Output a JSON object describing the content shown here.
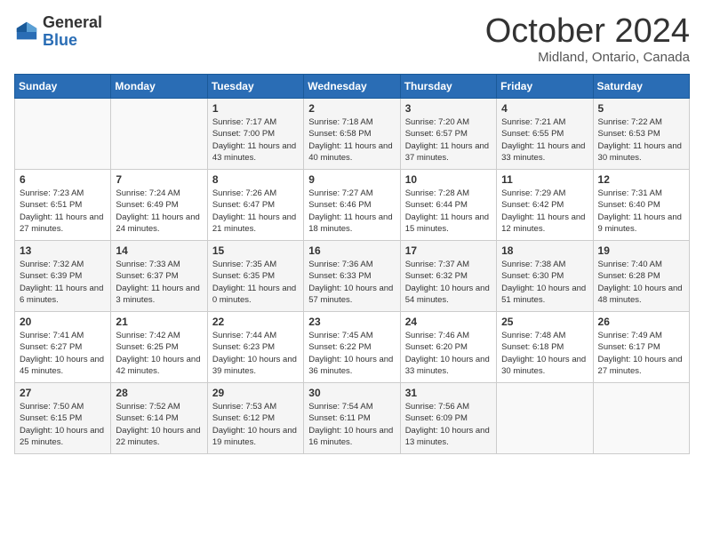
{
  "logo": {
    "general": "General",
    "blue": "Blue"
  },
  "title": "October 2024",
  "location": "Midland, Ontario, Canada",
  "weekdays": [
    "Sunday",
    "Monday",
    "Tuesday",
    "Wednesday",
    "Thursday",
    "Friday",
    "Saturday"
  ],
  "days": [
    {
      "date": null,
      "sunrise": null,
      "sunset": null,
      "daylight": null
    },
    {
      "date": null,
      "sunrise": null,
      "sunset": null,
      "daylight": null
    },
    {
      "date": "1",
      "sunrise": "Sunrise: 7:17 AM",
      "sunset": "Sunset: 7:00 PM",
      "daylight": "Daylight: 11 hours and 43 minutes."
    },
    {
      "date": "2",
      "sunrise": "Sunrise: 7:18 AM",
      "sunset": "Sunset: 6:58 PM",
      "daylight": "Daylight: 11 hours and 40 minutes."
    },
    {
      "date": "3",
      "sunrise": "Sunrise: 7:20 AM",
      "sunset": "Sunset: 6:57 PM",
      "daylight": "Daylight: 11 hours and 37 minutes."
    },
    {
      "date": "4",
      "sunrise": "Sunrise: 7:21 AM",
      "sunset": "Sunset: 6:55 PM",
      "daylight": "Daylight: 11 hours and 33 minutes."
    },
    {
      "date": "5",
      "sunrise": "Sunrise: 7:22 AM",
      "sunset": "Sunset: 6:53 PM",
      "daylight": "Daylight: 11 hours and 30 minutes."
    },
    {
      "date": "6",
      "sunrise": "Sunrise: 7:23 AM",
      "sunset": "Sunset: 6:51 PM",
      "daylight": "Daylight: 11 hours and 27 minutes."
    },
    {
      "date": "7",
      "sunrise": "Sunrise: 7:24 AM",
      "sunset": "Sunset: 6:49 PM",
      "daylight": "Daylight: 11 hours and 24 minutes."
    },
    {
      "date": "8",
      "sunrise": "Sunrise: 7:26 AM",
      "sunset": "Sunset: 6:47 PM",
      "daylight": "Daylight: 11 hours and 21 minutes."
    },
    {
      "date": "9",
      "sunrise": "Sunrise: 7:27 AM",
      "sunset": "Sunset: 6:46 PM",
      "daylight": "Daylight: 11 hours and 18 minutes."
    },
    {
      "date": "10",
      "sunrise": "Sunrise: 7:28 AM",
      "sunset": "Sunset: 6:44 PM",
      "daylight": "Daylight: 11 hours and 15 minutes."
    },
    {
      "date": "11",
      "sunrise": "Sunrise: 7:29 AM",
      "sunset": "Sunset: 6:42 PM",
      "daylight": "Daylight: 11 hours and 12 minutes."
    },
    {
      "date": "12",
      "sunrise": "Sunrise: 7:31 AM",
      "sunset": "Sunset: 6:40 PM",
      "daylight": "Daylight: 11 hours and 9 minutes."
    },
    {
      "date": "13",
      "sunrise": "Sunrise: 7:32 AM",
      "sunset": "Sunset: 6:39 PM",
      "daylight": "Daylight: 11 hours and 6 minutes."
    },
    {
      "date": "14",
      "sunrise": "Sunrise: 7:33 AM",
      "sunset": "Sunset: 6:37 PM",
      "daylight": "Daylight: 11 hours and 3 minutes."
    },
    {
      "date": "15",
      "sunrise": "Sunrise: 7:35 AM",
      "sunset": "Sunset: 6:35 PM",
      "daylight": "Daylight: 11 hours and 0 minutes."
    },
    {
      "date": "16",
      "sunrise": "Sunrise: 7:36 AM",
      "sunset": "Sunset: 6:33 PM",
      "daylight": "Daylight: 10 hours and 57 minutes."
    },
    {
      "date": "17",
      "sunrise": "Sunrise: 7:37 AM",
      "sunset": "Sunset: 6:32 PM",
      "daylight": "Daylight: 10 hours and 54 minutes."
    },
    {
      "date": "18",
      "sunrise": "Sunrise: 7:38 AM",
      "sunset": "Sunset: 6:30 PM",
      "daylight": "Daylight: 10 hours and 51 minutes."
    },
    {
      "date": "19",
      "sunrise": "Sunrise: 7:40 AM",
      "sunset": "Sunset: 6:28 PM",
      "daylight": "Daylight: 10 hours and 48 minutes."
    },
    {
      "date": "20",
      "sunrise": "Sunrise: 7:41 AM",
      "sunset": "Sunset: 6:27 PM",
      "daylight": "Daylight: 10 hours and 45 minutes."
    },
    {
      "date": "21",
      "sunrise": "Sunrise: 7:42 AM",
      "sunset": "Sunset: 6:25 PM",
      "daylight": "Daylight: 10 hours and 42 minutes."
    },
    {
      "date": "22",
      "sunrise": "Sunrise: 7:44 AM",
      "sunset": "Sunset: 6:23 PM",
      "daylight": "Daylight: 10 hours and 39 minutes."
    },
    {
      "date": "23",
      "sunrise": "Sunrise: 7:45 AM",
      "sunset": "Sunset: 6:22 PM",
      "daylight": "Daylight: 10 hours and 36 minutes."
    },
    {
      "date": "24",
      "sunrise": "Sunrise: 7:46 AM",
      "sunset": "Sunset: 6:20 PM",
      "daylight": "Daylight: 10 hours and 33 minutes."
    },
    {
      "date": "25",
      "sunrise": "Sunrise: 7:48 AM",
      "sunset": "Sunset: 6:18 PM",
      "daylight": "Daylight: 10 hours and 30 minutes."
    },
    {
      "date": "26",
      "sunrise": "Sunrise: 7:49 AM",
      "sunset": "Sunset: 6:17 PM",
      "daylight": "Daylight: 10 hours and 27 minutes."
    },
    {
      "date": "27",
      "sunrise": "Sunrise: 7:50 AM",
      "sunset": "Sunset: 6:15 PM",
      "daylight": "Daylight: 10 hours and 25 minutes."
    },
    {
      "date": "28",
      "sunrise": "Sunrise: 7:52 AM",
      "sunset": "Sunset: 6:14 PM",
      "daylight": "Daylight: 10 hours and 22 minutes."
    },
    {
      "date": "29",
      "sunrise": "Sunrise: 7:53 AM",
      "sunset": "Sunset: 6:12 PM",
      "daylight": "Daylight: 10 hours and 19 minutes."
    },
    {
      "date": "30",
      "sunrise": "Sunrise: 7:54 AM",
      "sunset": "Sunset: 6:11 PM",
      "daylight": "Daylight: 10 hours and 16 minutes."
    },
    {
      "date": "31",
      "sunrise": "Sunrise: 7:56 AM",
      "sunset": "Sunset: 6:09 PM",
      "daylight": "Daylight: 10 hours and 13 minutes."
    },
    {
      "date": null,
      "sunrise": null,
      "sunset": null,
      "daylight": null
    },
    {
      "date": null,
      "sunrise": null,
      "sunset": null,
      "daylight": null
    }
  ]
}
